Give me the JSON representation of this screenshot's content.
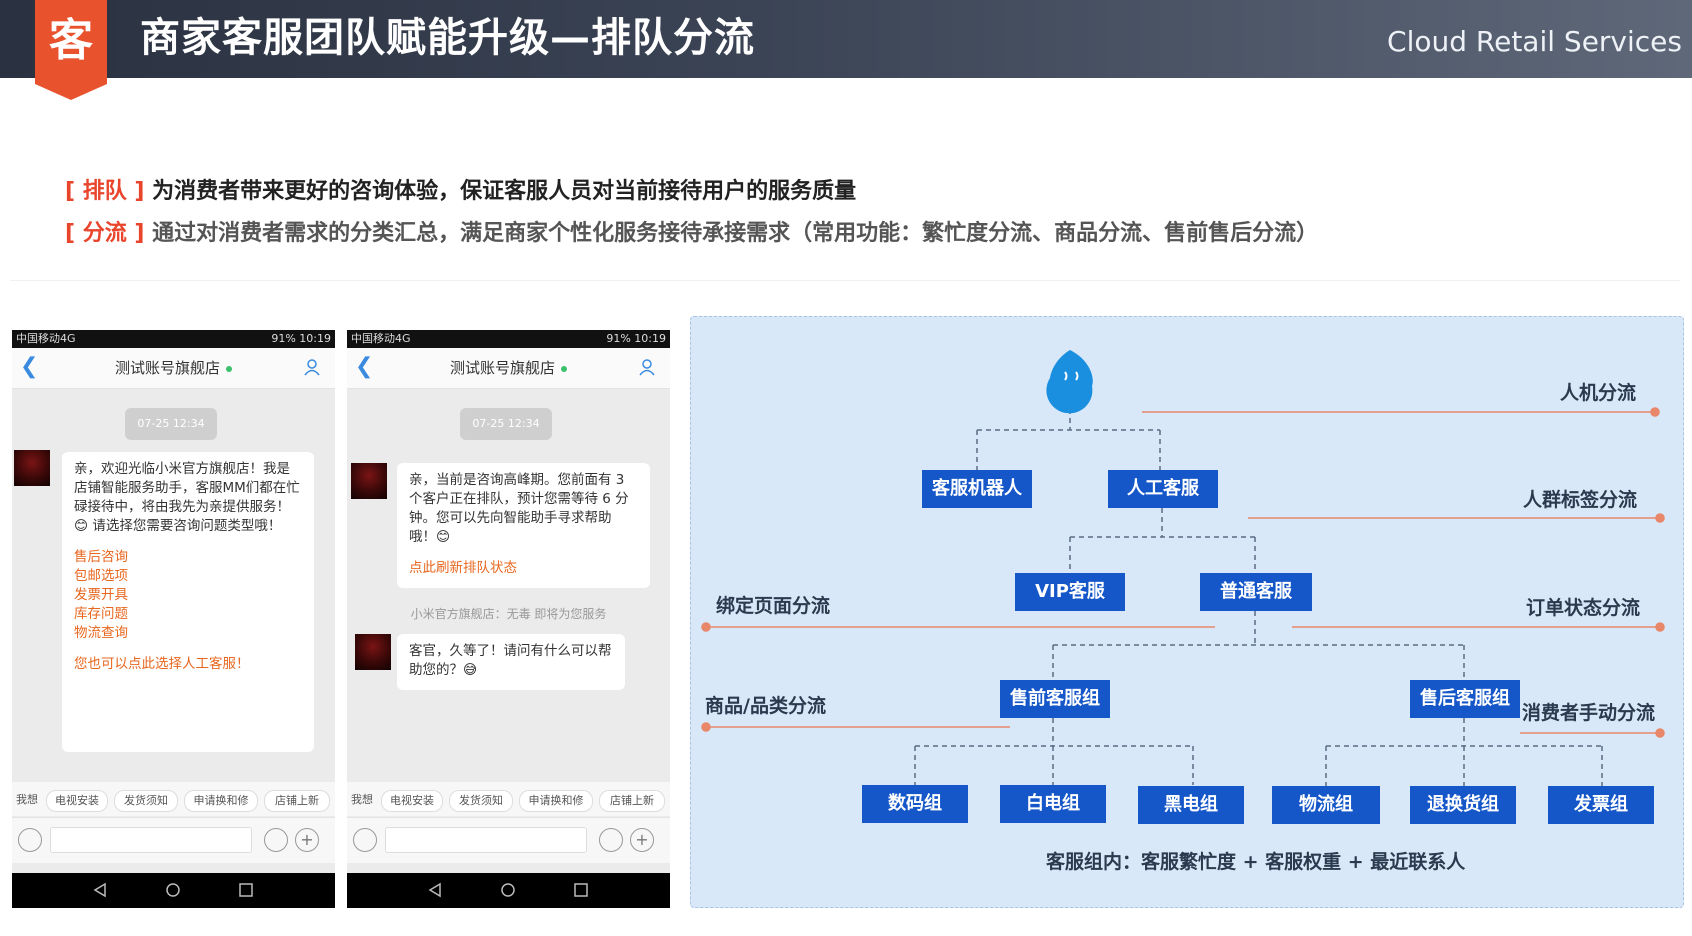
{
  "header": {
    "badge_char": "客",
    "title": "商家客服团队赋能升级—排队分流",
    "brand": "Cloud Retail Services",
    "colors": {
      "badge": "#e8532e",
      "header_bg": "#333b4a"
    }
  },
  "intro": {
    "line1_tag": "[ 排队 ]",
    "line1_text": "为消费者带来更好的咨询体验，保证客服人员对当前接待用户的服务质量",
    "line2_tag": "[ 分流 ]",
    "line2_text": "通过对消费者需求的分类汇总，满足商家个性化服务接待承接需求（常用功能：繁忙度分流、商品分流、售前售后分流）"
  },
  "phone1": {
    "carrier": "中国移动4G",
    "status_right": "91%  10:19",
    "store_name": "测试账号旗舰店",
    "time_pill": "07-25 12:34",
    "message": "亲，欢迎光临小米官方旗舰店！我是店铺智能服务助手，客服MM们都在忙碌接待中，将由我先为亲提供服务！😊 请选择您需要咨询问题类型哦！",
    "options": [
      "售后咨询",
      "包邮选项",
      "发票开具",
      "库存问题",
      "物流查询"
    ],
    "option_footer": "您也可以点此选择人工客服！",
    "quick_first": "我想",
    "quick_items": [
      "电视安装",
      "发货须知",
      "申请换和修",
      "店铺上新"
    ]
  },
  "phone2": {
    "carrier": "中国移动4G",
    "status_right": "91%  10:19",
    "store_name": "测试账号旗舰店",
    "time_pill": "07-25 12:34",
    "message": "亲，当前是咨询高峰期。您前面有 3 个客户正在排队，预计您需等待 6 分钟。您可以先向智能助手寻求帮助哦！😊",
    "refresh_link": "点此刷新排队状态",
    "system_note": "小米官方旗舰店：无毒 即将为您服务",
    "reply": "客官，久等了！请问有什么可以帮助您的？😅",
    "quick_first": "我想",
    "quick_items": [
      "电视安装",
      "发货须知",
      "申请换和修",
      "店铺上新"
    ]
  },
  "diagram": {
    "nodes": {
      "bot": "客服机器人",
      "human": "人工客服",
      "vip": "VIP客服",
      "normal": "普通客服",
      "presale": "售前客服组",
      "aftersale": "售后客服组",
      "digital": "数码组",
      "white": "白电组",
      "black": "黑电组",
      "logistics": "物流组",
      "refund": "退换货组",
      "invoice": "发票组"
    },
    "labels": {
      "human_machine": "人机分流",
      "crowd_tag": "人群标签分流",
      "bind_page": "绑定页面分流",
      "order_status": "订单状态分流",
      "product_category": "商品/品类分流",
      "consumer_manual": "消费者手动分流"
    },
    "footer": "客服组内：客服繁忙度 + 客服权重 + 最近联系人",
    "colors": {
      "node": "#1557c9",
      "line": "#e8876a",
      "panel": "#d9e8f9"
    }
  }
}
